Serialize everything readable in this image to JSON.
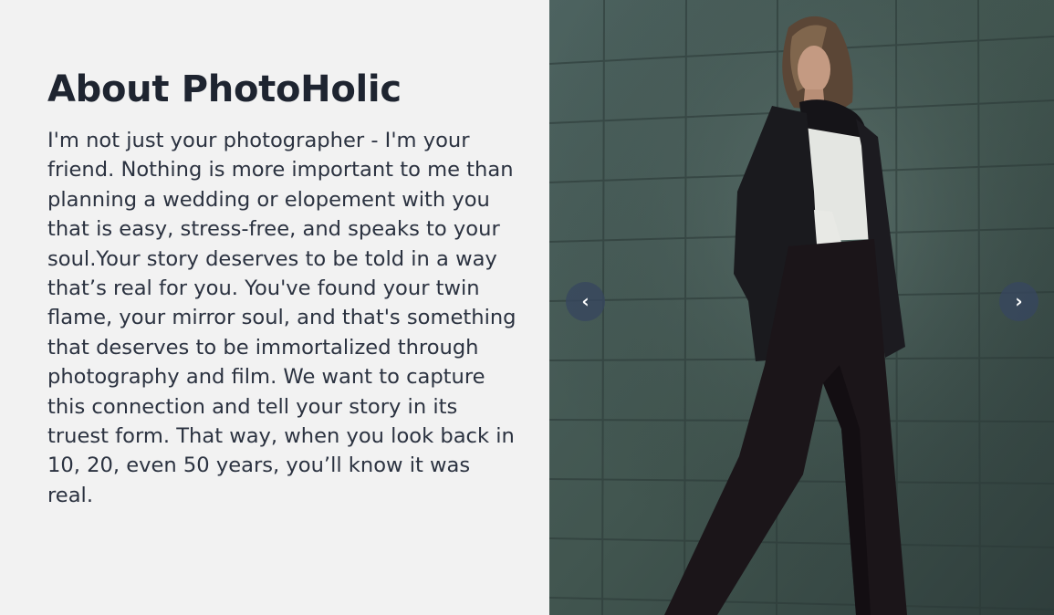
{
  "about": {
    "title": "About PhotoHolic",
    "body": "I'm not just your photographer - I'm your friend. Nothing is more important to me than planning a wedding or elopement with you that is easy, stress-free, and speaks to your soul.Your story deserves to be told in a way that’s real for you. You've found your twin flame, your mirror soul, and that's something that deserves to be immortalized through photography and film. We want to capture this connection and tell your story in its truest form. That way, when you look back in 10, 20, even 50 years, you’ll know it was real."
  },
  "carousel": {
    "prev_icon": "‹",
    "next_icon": "›"
  },
  "colors": {
    "background": "#f2f2f2",
    "title": "#1e2430",
    "text": "#2b3240",
    "wall": "#3f5350",
    "button": "#37465f"
  }
}
